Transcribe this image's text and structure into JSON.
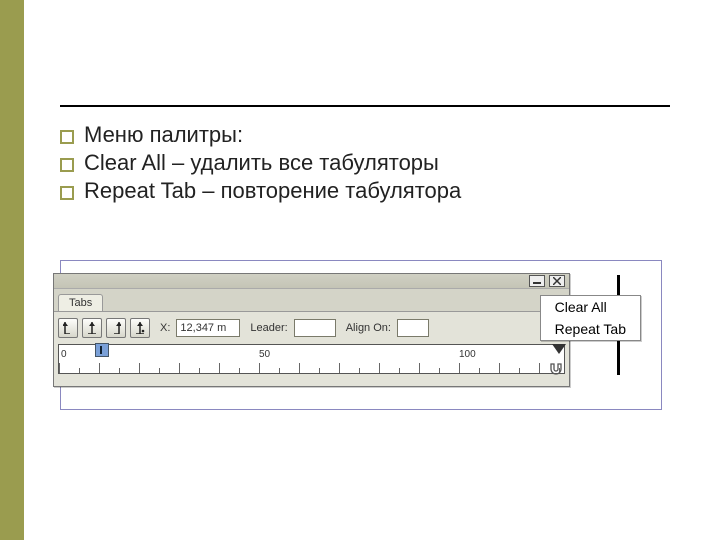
{
  "bullets": {
    "b0": "Меню палитры:",
    "b1": "Clear All – удалить все табуляторы",
    "b2": "Repeat Tab – повторение табулятора"
  },
  "palette": {
    "tab_label": "Tabs",
    "x_label": "X:",
    "x_value": "12,347 m",
    "leader_label": "Leader:",
    "leader_value": "",
    "align_label": "Align On:",
    "align_value": "",
    "ruler_labels": {
      "l0": "0",
      "l50": "50",
      "l100": "100"
    }
  },
  "flyout": {
    "item_clear_all": "Clear All",
    "item_repeat_tab": "Repeat Tab"
  }
}
